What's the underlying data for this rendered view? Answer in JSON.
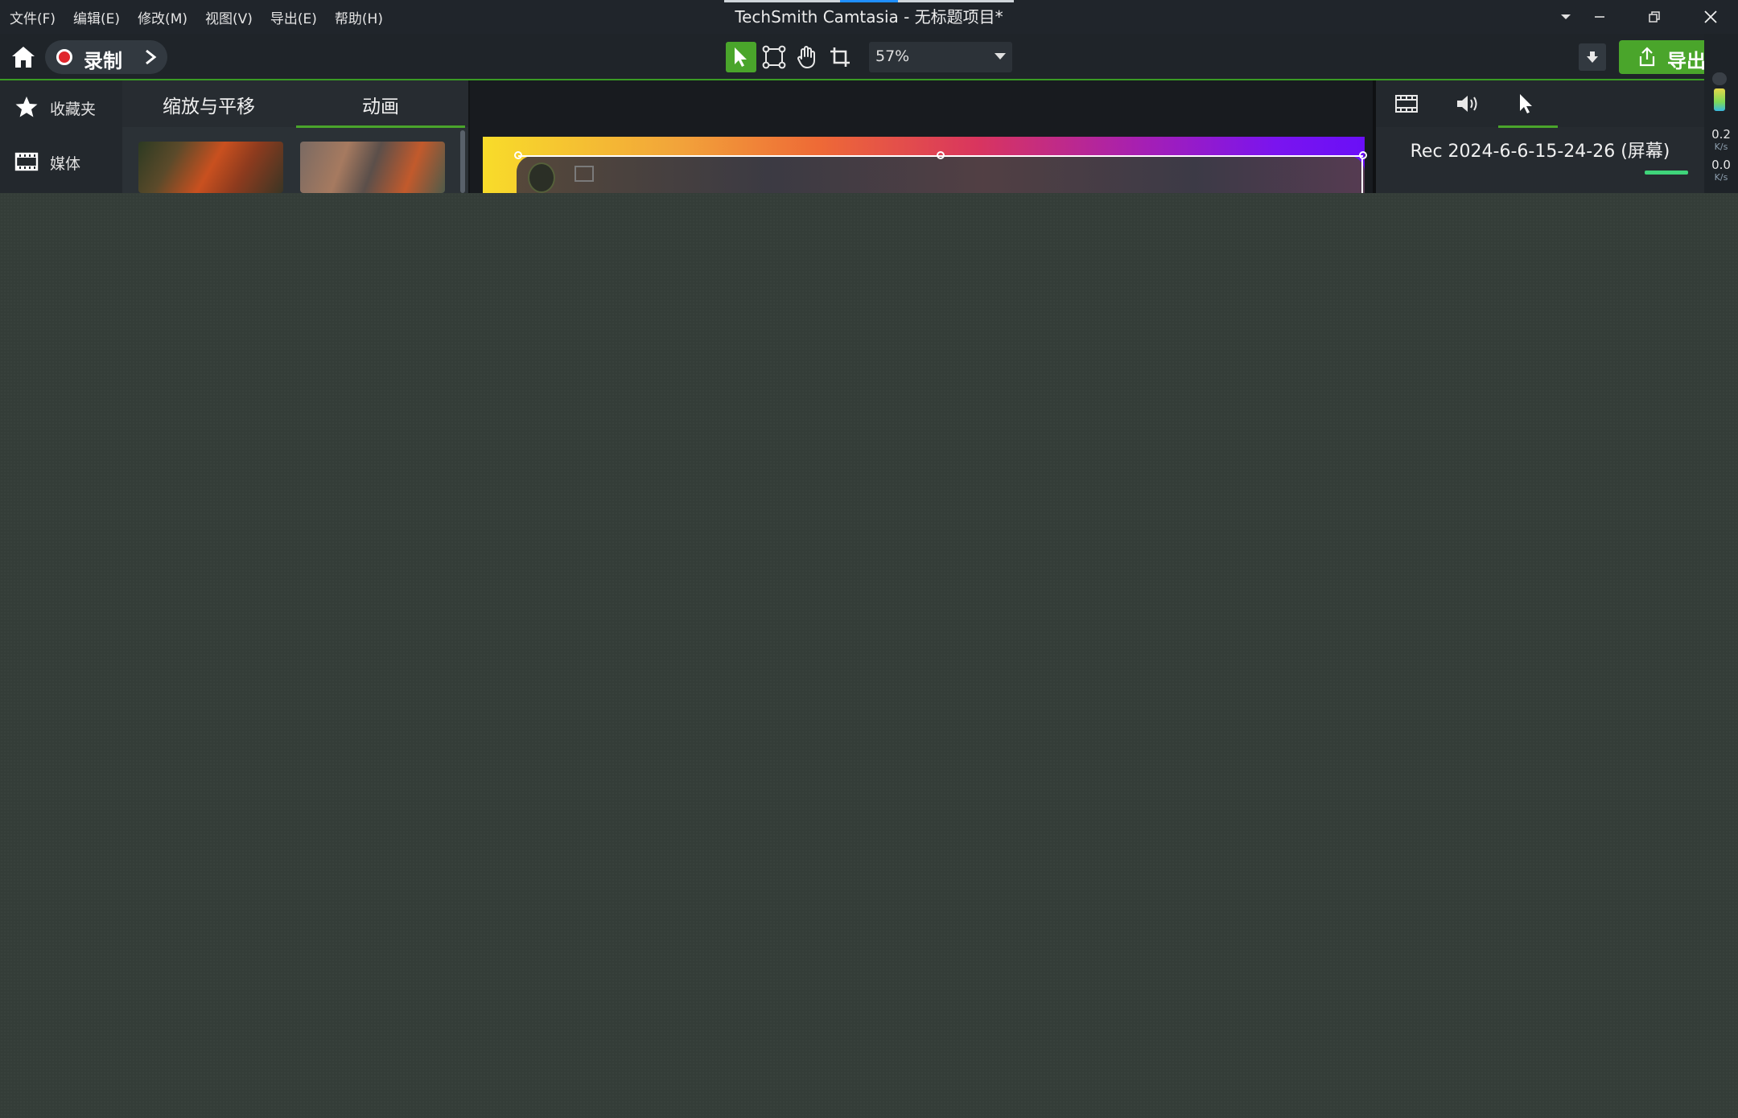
{
  "app": {
    "title": "TechSmith Camtasia - 无标题项目*"
  },
  "menu": {
    "items": [
      "文件(F)",
      "编辑(E)",
      "修改(M)",
      "视图(V)",
      "导出(E)",
      "帮助(H)"
    ]
  },
  "toolbar": {
    "record_label": "录制",
    "zoom_value": "57%",
    "export_label": "导出"
  },
  "sidebar": {
    "items": [
      {
        "label": "收藏夹",
        "icon": "star-icon"
      },
      {
        "label": "媒体",
        "icon": "film-icon"
      }
    ]
  },
  "media_panel": {
    "tabs": [
      "缩放与平移",
      "动画"
    ],
    "selected_tab": "动画"
  },
  "properties": {
    "tabs": [
      "video-properties",
      "audio-properties",
      "cursor-properties"
    ],
    "clip_name": "Rec 2024-6-6-15-24-26 (屏幕)"
  },
  "meter": {
    "value_top": "0.2",
    "unit_top": "K/s",
    "value_bottom": "0.0",
    "unit_bottom": "K/s"
  },
  "colors": {
    "accent_green": "#4aa52b",
    "record_red": "#e0262c",
    "status_green": "#2ec96b",
    "gradient_start": "#f8dc2a",
    "gradient_end": "#6a0ff7"
  }
}
